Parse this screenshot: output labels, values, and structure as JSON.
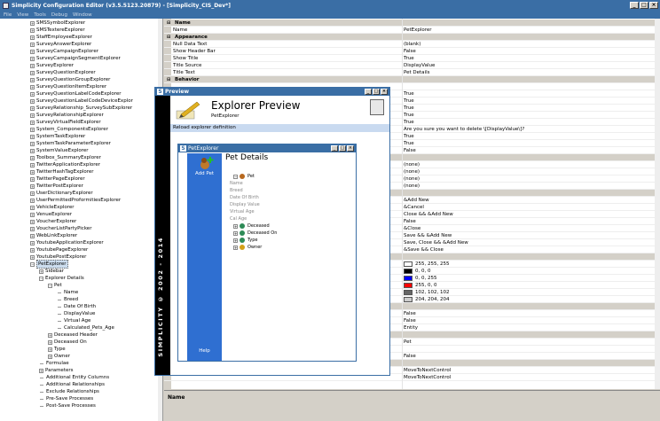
{
  "window": {
    "title": "Simplicity Configuration Editor (v3.5.5123.20879) - [Simplicity_CIS_Dev*]",
    "controls": [
      "_",
      "□",
      "×"
    ]
  },
  "menu": [
    "File",
    "View",
    "Tools",
    "Debug",
    "Window"
  ],
  "tree": {
    "items": [
      {
        "label": "SMSSymbolExplorer",
        "depth": 3,
        "type": "collapsed"
      },
      {
        "label": "SMSTextereExplorer",
        "depth": 3,
        "type": "collapsed"
      },
      {
        "label": "StaffEmployeeExplorer",
        "depth": 3,
        "type": "collapsed"
      },
      {
        "label": "SurveyAnswerExplorer",
        "depth": 3,
        "type": "collapsed"
      },
      {
        "label": "SurveyCampaignExplorer",
        "depth": 3,
        "type": "collapsed"
      },
      {
        "label": "SurveyCampaignSegmentExplorer",
        "depth": 3,
        "type": "collapsed"
      },
      {
        "label": "SurveyExplorer",
        "depth": 3,
        "type": "collapsed"
      },
      {
        "label": "SurveyQuestionExplorer",
        "depth": 3,
        "type": "collapsed"
      },
      {
        "label": "SurveyQuestionGroupExplorer",
        "depth": 3,
        "type": "collapsed"
      },
      {
        "label": "SurveyQuestionItemExplorer",
        "depth": 3,
        "type": "collapsed"
      },
      {
        "label": "SurveyQuestionLabelCodeExplorer",
        "depth": 3,
        "type": "collapsed"
      },
      {
        "label": "SurveyQuestionLabelCodeDeviceExplor",
        "depth": 3,
        "type": "collapsed"
      },
      {
        "label": "SurveyRelationship_SurveySubExplorer",
        "depth": 3,
        "type": "collapsed"
      },
      {
        "label": "SurveyRelationshipExplorer",
        "depth": 3,
        "type": "collapsed"
      },
      {
        "label": "SurveyVirtualFieldExplorer",
        "depth": 3,
        "type": "collapsed"
      },
      {
        "label": "System_ComponentsExplorer",
        "depth": 3,
        "type": "collapsed"
      },
      {
        "label": "SystemTaskExplorer",
        "depth": 3,
        "type": "collapsed"
      },
      {
        "label": "SystemTaskParameterExplorer",
        "depth": 3,
        "type": "collapsed"
      },
      {
        "label": "SystemValueExplorer",
        "depth": 3,
        "type": "collapsed"
      },
      {
        "label": "Toolbox_SummaryExplorer",
        "depth": 3,
        "type": "collapsed"
      },
      {
        "label": "TwitterApplicationExplorer",
        "depth": 3,
        "type": "collapsed"
      },
      {
        "label": "TwitterHashTagExplorer",
        "depth": 3,
        "type": "collapsed"
      },
      {
        "label": "TwitterPageExplorer",
        "depth": 3,
        "type": "collapsed"
      },
      {
        "label": "TwitterPostExplorer",
        "depth": 3,
        "type": "collapsed"
      },
      {
        "label": "UserDictionaryExplorer",
        "depth": 3,
        "type": "collapsed"
      },
      {
        "label": "UserPermittedProformitiesExplorer",
        "depth": 3,
        "type": "collapsed"
      },
      {
        "label": "VehicleExplorer",
        "depth": 3,
        "type": "collapsed"
      },
      {
        "label": "VenueExplorer",
        "depth": 3,
        "type": "collapsed"
      },
      {
        "label": "VoucherExplorer",
        "depth": 3,
        "type": "collapsed"
      },
      {
        "label": "VoucherListPartyPicker",
        "depth": 3,
        "type": "collapsed"
      },
      {
        "label": "WebLinkExplorer",
        "depth": 3,
        "type": "collapsed"
      },
      {
        "label": "YoutubeApplicationExplorer",
        "depth": 3,
        "type": "collapsed"
      },
      {
        "label": "YoutubePageExplorer",
        "depth": 3,
        "type": "collapsed"
      },
      {
        "label": "YoutubePostExplorer",
        "depth": 3,
        "type": "collapsed"
      },
      {
        "label": "PetExplorer",
        "depth": 3,
        "type": "expanded",
        "selected": true
      },
      {
        "label": "Sidebar",
        "depth": 4,
        "type": "collapsed"
      },
      {
        "label": "Explorer Details",
        "depth": 4,
        "type": "expanded"
      },
      {
        "label": "Pet",
        "depth": 5,
        "type": "expanded"
      },
      {
        "label": "Name",
        "depth": 6,
        "type": "leaf"
      },
      {
        "label": "Breed",
        "depth": 6,
        "type": "leaf"
      },
      {
        "label": "Date Of Birth",
        "depth": 6,
        "type": "leaf"
      },
      {
        "label": "DisplayValue",
        "depth": 6,
        "type": "leaf"
      },
      {
        "label": "Virtual Age",
        "depth": 6,
        "type": "leaf"
      },
      {
        "label": "Calculated_Pets_Age",
        "depth": 6,
        "type": "leaf"
      },
      {
        "label": "Deceased Header",
        "depth": 5,
        "type": "collapsed"
      },
      {
        "label": "Deceased On",
        "depth": 5,
        "type": "collapsed"
      },
      {
        "label": "Type",
        "depth": 5,
        "type": "collapsed"
      },
      {
        "label": "Owner",
        "depth": 5,
        "type": "collapsed"
      },
      {
        "label": "Formulae",
        "depth": 4,
        "type": "leaf"
      },
      {
        "label": "Parameters",
        "depth": 4,
        "type": "collapsed"
      },
      {
        "label": "Additional Entity Columns",
        "depth": 4,
        "type": "leaf"
      },
      {
        "label": "Additional Relationships",
        "depth": 4,
        "type": "leaf"
      },
      {
        "label": "Exclude Relationships",
        "depth": 4,
        "type": "leaf"
      },
      {
        "label": "Pre-Save Processes",
        "depth": 4,
        "type": "leaf"
      },
      {
        "label": "Post-Save Processes",
        "depth": 4,
        "type": "leaf"
      }
    ]
  },
  "grid": {
    "rows": [
      {
        "kind": "cat",
        "name": "Name"
      },
      {
        "kind": "row",
        "name": "Name",
        "value": "PetExplorer"
      },
      {
        "kind": "cat",
        "name": "Appearance"
      },
      {
        "kind": "row",
        "name": "Null Data Text",
        "value": "(blank)"
      },
      {
        "kind": "row",
        "name": "Show Header Bar",
        "value": "False"
      },
      {
        "kind": "row",
        "name": "Show Title",
        "value": "True"
      },
      {
        "kind": "row",
        "name": "Title Source",
        "value": "DisplayValue"
      },
      {
        "kind": "row",
        "name": "Title Text",
        "value": "Pet Details"
      },
      {
        "kind": "cat",
        "name": "Behavior"
      },
      {
        "kind": "row",
        "name": "",
        "value": ""
      },
      {
        "kind": "row",
        "name": "",
        "value": "True"
      },
      {
        "kind": "row",
        "name": "",
        "value": "True"
      },
      {
        "kind": "row",
        "name": "",
        "value": "True"
      },
      {
        "kind": "row",
        "name": "",
        "value": "True"
      },
      {
        "kind": "row",
        "name": "",
        "value": "True"
      },
      {
        "kind": "row",
        "name": "",
        "value": "Are you sure you want to delete \\[DisplayValue\\]?"
      },
      {
        "kind": "row",
        "name": "",
        "value": "True"
      },
      {
        "kind": "row",
        "name": "",
        "value": "True"
      },
      {
        "kind": "row",
        "name": "",
        "value": "False"
      },
      {
        "kind": "cat",
        "name": ""
      },
      {
        "kind": "row",
        "name": "",
        "value": "(none)"
      },
      {
        "kind": "row",
        "name": "",
        "value": "(none)"
      },
      {
        "kind": "row",
        "name": "",
        "value": "(none)"
      },
      {
        "kind": "row",
        "name": "",
        "value": "(none)"
      },
      {
        "kind": "cat",
        "name": ""
      },
      {
        "kind": "row",
        "name": "",
        "value": "&Add New"
      },
      {
        "kind": "row",
        "name": "",
        "value": "&Cancel"
      },
      {
        "kind": "row",
        "name": "",
        "value": "Close && &Add New"
      },
      {
        "kind": "row",
        "name": "",
        "value": "False"
      },
      {
        "kind": "row",
        "name": "",
        "value": "&Close"
      },
      {
        "kind": "row",
        "name": "",
        "value": "Save && &Add New"
      },
      {
        "kind": "row",
        "name": "",
        "value": "Save, Close && &Add New"
      },
      {
        "kind": "row",
        "name": "",
        "value": "&Save && Close"
      },
      {
        "kind": "cat",
        "name": ""
      },
      {
        "kind": "row",
        "name": "",
        "value": "255, 255, 255",
        "swatch": "#ffffff"
      },
      {
        "kind": "row",
        "name": "",
        "value": "0, 0, 0",
        "swatch": "#000000"
      },
      {
        "kind": "row",
        "name": "",
        "value": "0, 0, 255",
        "swatch": "#0000ff"
      },
      {
        "kind": "row",
        "name": "",
        "value": "255, 0, 0",
        "swatch": "#ff0000"
      },
      {
        "kind": "row",
        "name": "",
        "value": "102, 102, 102",
        "swatch": "#666666"
      },
      {
        "kind": "row",
        "name": "",
        "value": "204, 204, 204",
        "swatch": "#cccccc"
      },
      {
        "kind": "cat",
        "name": ""
      },
      {
        "kind": "row",
        "name": "",
        "value": "False"
      },
      {
        "kind": "row",
        "name": "",
        "value": "False"
      },
      {
        "kind": "row",
        "name": "",
        "value": "Entity"
      },
      {
        "kind": "cat",
        "name": ""
      },
      {
        "kind": "row",
        "name": "",
        "value": "Pet"
      },
      {
        "kind": "row",
        "name": "",
        "value": ""
      },
      {
        "kind": "row",
        "name": "",
        "value": "False"
      },
      {
        "kind": "cat",
        "name": ""
      },
      {
        "kind": "row",
        "name": "",
        "value": "MoveToNextControl"
      },
      {
        "kind": "row",
        "name": "",
        "value": "MoveToNextControl"
      }
    ]
  },
  "description": {
    "title": "Name"
  },
  "preview": {
    "title": "Preview",
    "header_title": "Explorer Preview",
    "header_sub": "PetExplorer",
    "toolbar_label": "Reload explorer definition",
    "sidebar_text": "SIMPLICITY © 2002 - 2014",
    "controls": [
      "_",
      "□",
      "×"
    ]
  },
  "pet_window": {
    "title": "PetExplorer",
    "controls": [
      "_",
      "□",
      "×"
    ],
    "add_label": "Add Pet",
    "help_label": "Help",
    "heading": "Pet Details",
    "rows": [
      {
        "label": "Pet",
        "kind": "node",
        "exp": "⊟",
        "icon": "#b8691f"
      },
      {
        "label": "Name",
        "kind": "field"
      },
      {
        "label": "Breed",
        "kind": "field"
      },
      {
        "label": "Date Of Birth",
        "kind": "field"
      },
      {
        "label": "Display Value",
        "kind": "field"
      },
      {
        "label": "Virtual Age",
        "kind": "field"
      },
      {
        "label": "Cal Age",
        "kind": "field"
      },
      {
        "label": "Deceased",
        "kind": "node",
        "exp": "⊞",
        "icon": "#2e8b57"
      },
      {
        "label": "Deceased On",
        "kind": "node",
        "exp": "⊞",
        "icon": "#2e8b57"
      },
      {
        "label": "Type",
        "kind": "node",
        "exp": "⊞",
        "icon": "#2e8b57"
      },
      {
        "label": "Owner",
        "kind": "node",
        "exp": "⊞",
        "icon": "#d4a017"
      }
    ]
  },
  "colors": {
    "titlebar": "#3a6ea5",
    "nav_blue": "#2f6fd1",
    "toolbar": "#c9daf0"
  }
}
